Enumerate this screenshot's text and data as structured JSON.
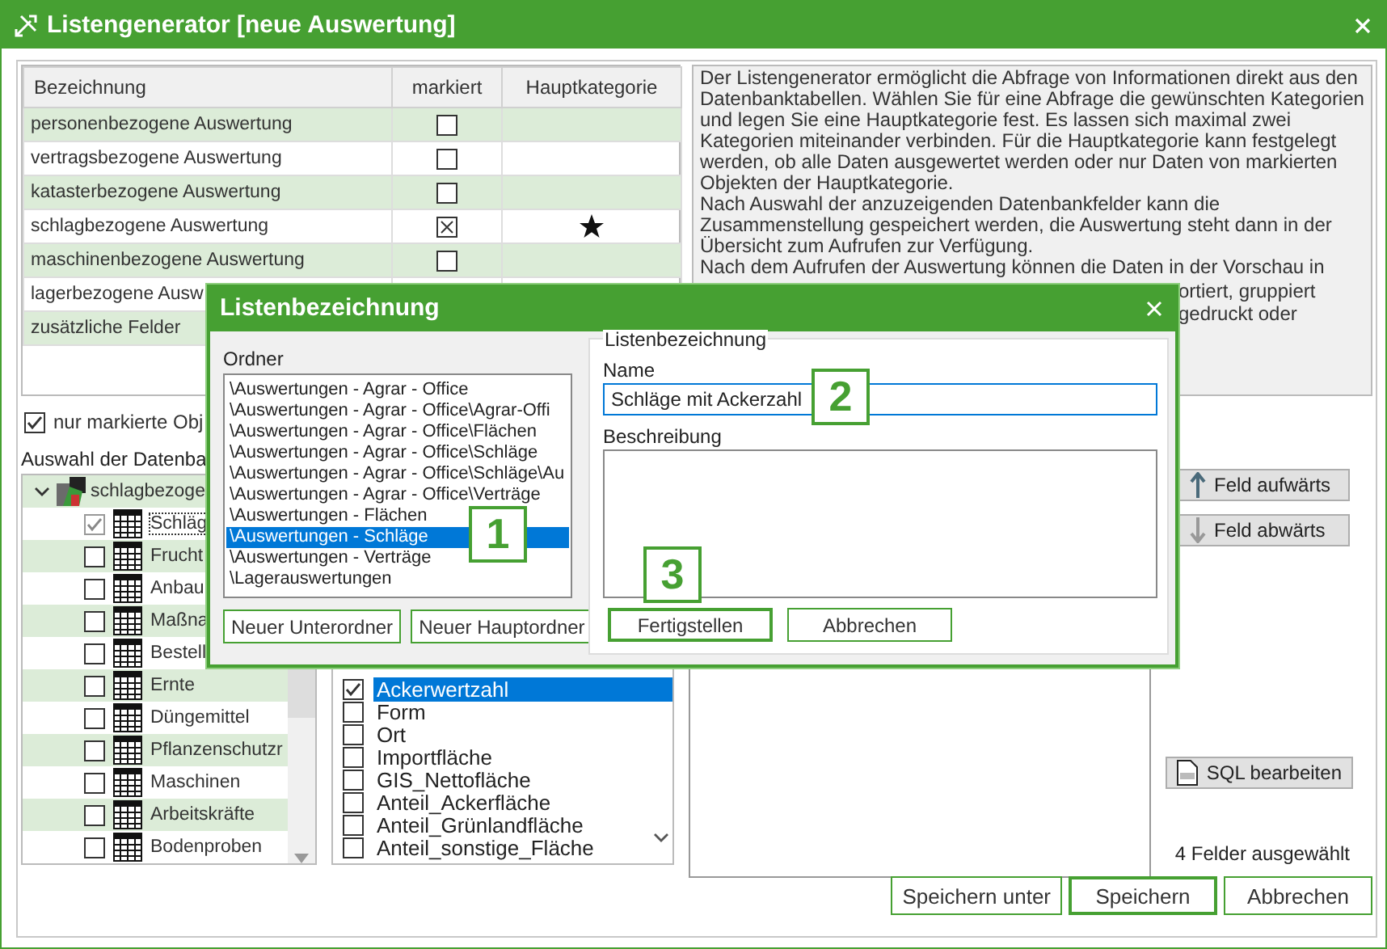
{
  "window": {
    "title": "Listengenerator [neue Auswertung]"
  },
  "categories": {
    "columns": [
      "Bezeichnung",
      "markiert",
      "Hauptkategorie"
    ],
    "rows": [
      {
        "label": "personenbezogene Auswertung",
        "marked": false,
        "main": false
      },
      {
        "label": "vertragsbezogene Auswertung",
        "marked": false,
        "main": false
      },
      {
        "label": "katasterbezogene Auswertung",
        "marked": false,
        "main": false
      },
      {
        "label": "schlagbezogene Auswertung",
        "marked": true,
        "main": true
      },
      {
        "label": "maschinenbezogene Auswertung",
        "marked": false,
        "main": false
      },
      {
        "label": "lagerbezogene Ausw"
      },
      {
        "label": "zusätzliche Felder"
      }
    ]
  },
  "only_marked": {
    "label": "nur markierte Obj",
    "checked": true
  },
  "description": {
    "paragraphs": [
      "Der Listengenerator ermöglicht die Abfrage von Informationen direkt aus den Datenbanktabellen. Wählen Sie für eine Abfrage die gewünschten Kategorien und legen Sie eine Hauptkategorie fest. Es lassen sich maximal zwei Kategorien miteinander verbinden. Für die Hauptkategorie kann festgelegt werden, ob alle Daten ausgewertet werden oder nur Daten von markierten Objekten der Hauptkategorie.",
      "Nach Auswahl der anzuzeigenden Datenbankfelder kann die Zusammenstellung gespeichert werden, die Auswertung steht dann in der Übersicht zum Aufrufen zur Verfügung.",
      "Nach dem Aufrufen der Auswertung können die Daten in der Vorschau in"
    ],
    "fragments": [
      "ortiert, gruppiert",
      "gedruckt oder"
    ]
  },
  "tables": {
    "label": "Auswahl der Datenba",
    "root": {
      "label": "schlagbezoge",
      "expanded": true,
      "children": [
        {
          "label": "Schläg",
          "checked": true
        },
        {
          "label": "Frucht",
          "checked": false
        },
        {
          "label": "Anbau",
          "checked": false
        },
        {
          "label": "Maßna",
          "checked": false
        },
        {
          "label": "Bestell",
          "checked": false
        },
        {
          "label": "Ernte",
          "checked": false
        },
        {
          "label": "Düngemittel",
          "checked": false
        },
        {
          "label": "Pflanzenschutzr",
          "checked": false
        },
        {
          "label": "Maschinen",
          "checked": false
        },
        {
          "label": "Arbeitskräfte",
          "checked": false
        },
        {
          "label": "Bodenproben",
          "checked": false
        }
      ]
    }
  },
  "fields": [
    {
      "label": "Ackerwertzahl",
      "checked": true,
      "selected": true
    },
    {
      "label": "Form",
      "checked": false,
      "selected": false
    },
    {
      "label": "Ort",
      "checked": false,
      "selected": false
    },
    {
      "label": "Importfläche",
      "checked": false,
      "selected": false
    },
    {
      "label": "GIS_Nettofläche",
      "checked": false,
      "selected": false
    },
    {
      "label": "Anteil_Ackerfläche",
      "checked": false,
      "selected": false
    },
    {
      "label": "Anteil_Grünlandfläche",
      "checked": false,
      "selected": false
    },
    {
      "label": "Anteil_sonstige_Fläche",
      "checked": false,
      "selected": false
    }
  ],
  "side_buttons": [
    {
      "label": "Feld aufwärts",
      "kind": "up"
    },
    {
      "label": "Feld abwärts",
      "kind": "down"
    },
    {
      "label": "SQL bearbeiten",
      "kind": "sql"
    }
  ],
  "selection_count": "4 Felder ausgewählt",
  "footer_buttons": [
    {
      "label": "Speichern unter",
      "default": false
    },
    {
      "label": "Speichern",
      "default": true
    },
    {
      "label": "Abbrechen",
      "default": false
    }
  ],
  "dialog": {
    "title": "Listenbezeichnung",
    "folder_label": "Ordner",
    "folders": [
      {
        "label": "\\Auswertungen - Agrar - Office",
        "selected": false
      },
      {
        "label": "\\Auswertungen - Agrar - Office\\Agrar-Offi",
        "selected": false
      },
      {
        "label": "\\Auswertungen - Agrar - Office\\Flächen",
        "selected": false
      },
      {
        "label": "\\Auswertungen - Agrar - Office\\Schläge",
        "selected": false
      },
      {
        "label": "\\Auswertungen - Agrar - Office\\Schläge\\Au",
        "selected": false
      },
      {
        "label": "\\Auswertungen - Agrar - Office\\Verträge",
        "selected": false
      },
      {
        "label": "\\Auswertungen - Flächen",
        "selected": false
      },
      {
        "label": "\\Auswertungen - Schläge",
        "selected": true
      },
      {
        "label": "\\Auswertungen - Verträge",
        "selected": false
      },
      {
        "label": "\\Lagerauswertungen",
        "selected": false
      }
    ],
    "folder_buttons": [
      "Neuer Unterordner",
      "Neuer Hauptordner"
    ],
    "group_label": "Listenbezeichnung",
    "name_label": "Name",
    "name_value": "Schläge mit Ackerzahl",
    "description_label": "Beschreibung",
    "buttons": [
      {
        "label": "Fertigstellen",
        "default": true
      },
      {
        "label": "Abbrechen",
        "default": false
      }
    ]
  },
  "callouts": [
    {
      "label": "1"
    },
    {
      "label": "2"
    },
    {
      "label": "3"
    }
  ]
}
